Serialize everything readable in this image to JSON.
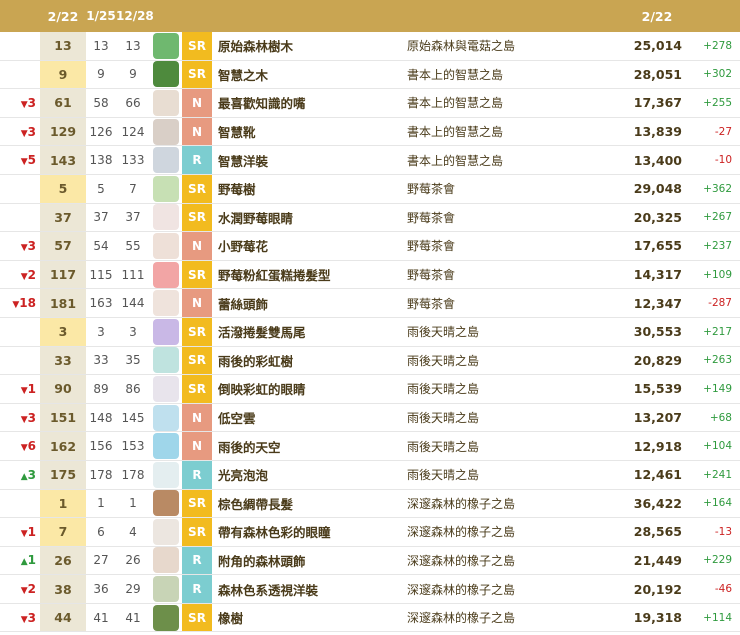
{
  "header": {
    "current_date": "2/22",
    "prev1_date": "1/25",
    "prev2_date": "12/28",
    "score_date": "2/22"
  },
  "rows": [
    {
      "change": "",
      "dir": "",
      "cur": "13",
      "p1": "13",
      "p2": "13",
      "rarity": "SR",
      "name": "原始森林樹木",
      "set": "原始森林與電菇之島",
      "score": "25,014",
      "diff": "+278",
      "thumb": "#6fb86f",
      "top": false
    },
    {
      "change": "",
      "dir": "",
      "cur": "9",
      "p1": "9",
      "p2": "9",
      "rarity": "SR",
      "name": "智慧之木",
      "set": "書本上的智慧之島",
      "score": "28,051",
      "diff": "+302",
      "thumb": "#4e8a3d",
      "top": true
    },
    {
      "change": "3",
      "dir": "down",
      "cur": "61",
      "p1": "58",
      "p2": "66",
      "rarity": "N",
      "name": "最喜歡知識的嘴",
      "set": "書本上的智慧之島",
      "score": "17,367",
      "diff": "+255",
      "thumb": "#e8ddd2",
      "top": false
    },
    {
      "change": "3",
      "dir": "down",
      "cur": "129",
      "p1": "126",
      "p2": "124",
      "rarity": "N",
      "name": "智慧靴",
      "set": "書本上的智慧之島",
      "score": "13,839",
      "diff": "-27",
      "thumb": "#d9cfc7",
      "top": false
    },
    {
      "change": "5",
      "dir": "down",
      "cur": "143",
      "p1": "138",
      "p2": "133",
      "rarity": "R",
      "name": "智慧洋裝",
      "set": "書本上的智慧之島",
      "score": "13,400",
      "diff": "-10",
      "thumb": "#cfd6de",
      "top": false
    },
    {
      "change": "",
      "dir": "",
      "cur": "5",
      "p1": "5",
      "p2": "7",
      "rarity": "SR",
      "name": "野莓樹",
      "set": "野莓茶會",
      "score": "29,048",
      "diff": "+362",
      "thumb": "#c7e0b4",
      "top": true
    },
    {
      "change": "",
      "dir": "",
      "cur": "37",
      "p1": "37",
      "p2": "37",
      "rarity": "SR",
      "name": "水潤野莓眼睛",
      "set": "野莓茶會",
      "score": "20,325",
      "diff": "+267",
      "thumb": "#f0e4e2",
      "top": false
    },
    {
      "change": "3",
      "dir": "down",
      "cur": "57",
      "p1": "54",
      "p2": "55",
      "rarity": "N",
      "name": "小野莓花",
      "set": "野莓茶會",
      "score": "17,655",
      "diff": "+237",
      "thumb": "#eee0d8",
      "top": false
    },
    {
      "change": "2",
      "dir": "down",
      "cur": "117",
      "p1": "115",
      "p2": "111",
      "rarity": "SR",
      "name": "野莓粉紅蛋糕捲髮型",
      "set": "野莓茶會",
      "score": "14,317",
      "diff": "+109",
      "thumb": "#f2a5a5",
      "top": false
    },
    {
      "change": "18",
      "dir": "down",
      "cur": "181",
      "p1": "163",
      "p2": "144",
      "rarity": "N",
      "name": "蕾絲頭飾",
      "set": "野莓茶會",
      "score": "12,347",
      "diff": "-287",
      "thumb": "#efe3dc",
      "top": false
    },
    {
      "change": "",
      "dir": "",
      "cur": "3",
      "p1": "3",
      "p2": "3",
      "rarity": "SR",
      "name": "活潑捲髮雙馬尾",
      "set": "雨後天晴之島",
      "score": "30,553",
      "diff": "+217",
      "thumb": "#c9b8e6",
      "top": true
    },
    {
      "change": "",
      "dir": "",
      "cur": "33",
      "p1": "33",
      "p2": "35",
      "rarity": "SR",
      "name": "雨後的彩虹樹",
      "set": "雨後天晴之島",
      "score": "20,829",
      "diff": "+263",
      "thumb": "#bfe3df",
      "top": false
    },
    {
      "change": "1",
      "dir": "down",
      "cur": "90",
      "p1": "89",
      "p2": "86",
      "rarity": "SR",
      "name": "倒映彩虹的眼睛",
      "set": "雨後天晴之島",
      "score": "15,539",
      "diff": "+149",
      "thumb": "#e8e4ec",
      "top": false
    },
    {
      "change": "3",
      "dir": "down",
      "cur": "151",
      "p1": "148",
      "p2": "145",
      "rarity": "N",
      "name": "低空雲",
      "set": "雨後天晴之島",
      "score": "13,207",
      "diff": "+68",
      "thumb": "#bfe0ee",
      "top": false
    },
    {
      "change": "6",
      "dir": "down",
      "cur": "162",
      "p1": "156",
      "p2": "153",
      "rarity": "N",
      "name": "雨後的天空",
      "set": "雨後天晴之島",
      "score": "12,918",
      "diff": "+104",
      "thumb": "#9fd6ea",
      "top": false
    },
    {
      "change": "3",
      "dir": "up",
      "cur": "175",
      "p1": "178",
      "p2": "178",
      "rarity": "R",
      "name": "光亮泡泡",
      "set": "雨後天晴之島",
      "score": "12,461",
      "diff": "+241",
      "thumb": "#e4eef0",
      "top": false
    },
    {
      "change": "",
      "dir": "",
      "cur": "1",
      "p1": "1",
      "p2": "1",
      "rarity": "SR",
      "name": "棕色綢帶長髮",
      "set": "深邃森林的橡子之島",
      "score": "36,422",
      "diff": "+164",
      "thumb": "#b98a64",
      "top": true
    },
    {
      "change": "1",
      "dir": "down",
      "cur": "7",
      "p1": "6",
      "p2": "4",
      "rarity": "SR",
      "name": "帶有森林色彩的眼瞳",
      "set": "深邃森林的橡子之島",
      "score": "28,565",
      "diff": "-13",
      "thumb": "#ece6e0",
      "top": true
    },
    {
      "change": "1",
      "dir": "up",
      "cur": "26",
      "p1": "27",
      "p2": "26",
      "rarity": "R",
      "name": "附角的森林頭飾",
      "set": "深邃森林的橡子之島",
      "score": "21,449",
      "diff": "+229",
      "thumb": "#e7d8cc",
      "top": false
    },
    {
      "change": "2",
      "dir": "down",
      "cur": "38",
      "p1": "36",
      "p2": "29",
      "rarity": "R",
      "name": "森林色系透視洋裝",
      "set": "深邃森林的橡子之島",
      "score": "20,192",
      "diff": "-46",
      "thumb": "#c8d4b6",
      "top": false
    },
    {
      "change": "3",
      "dir": "down",
      "cur": "44",
      "p1": "41",
      "p2": "41",
      "rarity": "SR",
      "name": "橡樹",
      "set": "深邃森林的橡子之島",
      "score": "19,318",
      "diff": "+114",
      "thumb": "#6d8f4a",
      "top": false
    }
  ],
  "colors": {
    "header_bg": "#c9a552",
    "rarity_SR": "#f2bb1f",
    "rarity_N": "#e79a80",
    "rarity_R": "#7ccdd0",
    "up": "#2f9a3e",
    "down": "#cc2222"
  }
}
